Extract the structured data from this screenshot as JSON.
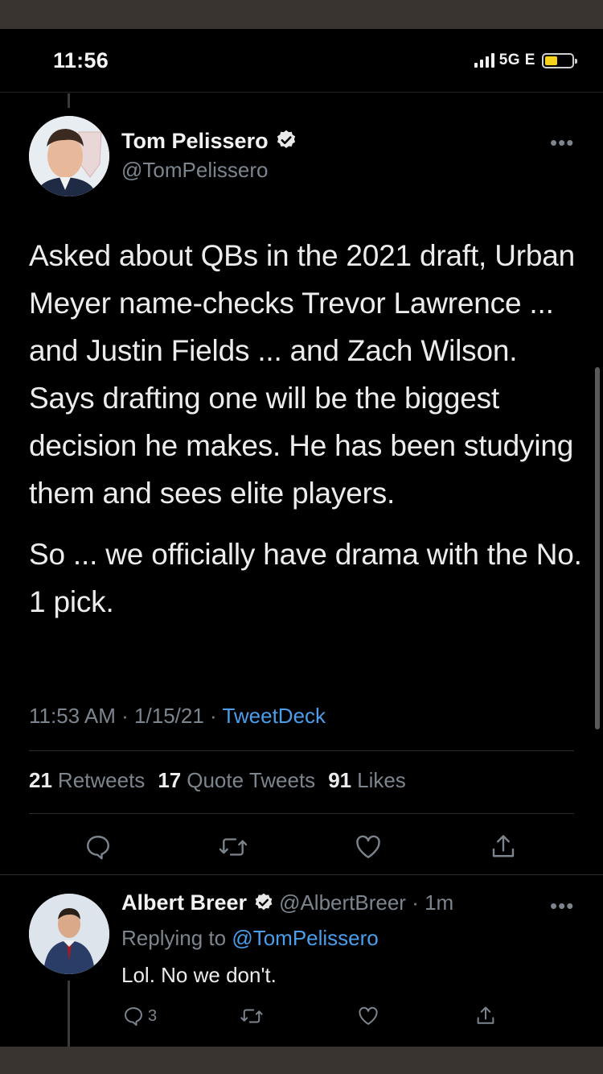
{
  "status": {
    "time": "11:56",
    "network": "5G E"
  },
  "tweet": {
    "author_name": "Tom Pelissero",
    "author_handle": "@TomPelissero",
    "more": "•••",
    "paragraph1": "Asked about QBs in the 2021 draft, Urban Meyer name-checks Trevor Lawrence ... and Justin Fields ... and Zach Wilson. Says drafting one will be the biggest decision he makes. He has been studying them and sees elite players.",
    "paragraph2": "So ... we officially have drama with the No. 1 pick.",
    "time": "11:53 AM",
    "date": "1/15/21",
    "source": "TweetDeck",
    "retweets_count": "21",
    "retweets_label": "Retweets",
    "quotes_count": "17",
    "quotes_label": "Quote Tweets",
    "likes_count": "91",
    "likes_label": "Likes"
  },
  "reply": {
    "author_name": "Albert Breer",
    "author_handle": "@AlbertBreer",
    "age": "1m",
    "replying_prefix": "Replying to",
    "replying_to": "@TomPelissero",
    "text": "Lol. No we don't.",
    "reply_count": "3",
    "more": "•••"
  },
  "colors": {
    "background": "#000000",
    "link": "#4a9eeb",
    "muted": "#7c858d",
    "text": "#ececec",
    "battery": "#f7d21d"
  },
  "icons": [
    "reply-icon",
    "retweet-icon",
    "like-icon",
    "share-icon",
    "verified-icon",
    "more-icon"
  ]
}
